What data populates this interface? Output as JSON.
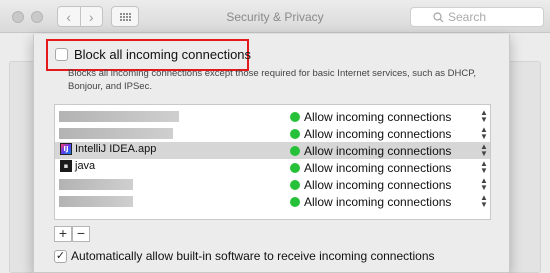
{
  "window": {
    "title": "Security & Privacy",
    "search_placeholder": "Search"
  },
  "firewall": {
    "block_all_label": "Block all incoming connections",
    "block_all_checked": false,
    "description": "Blocks all incoming connections except those required for basic Internet services,  such as DHCP, Bonjour, and IPSec.",
    "apps": [
      {
        "name": "",
        "icon": "blurred-app-name",
        "status": "Allow incoming connections",
        "status_color": "#27c139",
        "selected": false
      },
      {
        "name": "",
        "icon": "blurred-app-name",
        "status": "Allow incoming connections",
        "status_color": "#27c139",
        "selected": false
      },
      {
        "name": "IntelliJ IDEA.app",
        "icon": "intellij-icon",
        "status": "Allow incoming connections",
        "status_color": "#27c139",
        "selected": true
      },
      {
        "name": "java",
        "icon": "terminal-exec-icon",
        "status": "Allow incoming connections",
        "status_color": "#27c139",
        "selected": false
      },
      {
        "name": "",
        "icon": "blurred-app-name",
        "status": "Allow incoming connections",
        "status_color": "#27c139",
        "selected": false
      },
      {
        "name": "",
        "icon": "blurred-app-name",
        "status": "Allow incoming connections",
        "status_color": "#27c139",
        "selected": false
      }
    ],
    "add_label": "+",
    "remove_label": "−",
    "auto_allow_label": "Automatically allow built-in software to receive incoming connections",
    "auto_allow_checked": true,
    "highlight_color": "#e3191b"
  }
}
